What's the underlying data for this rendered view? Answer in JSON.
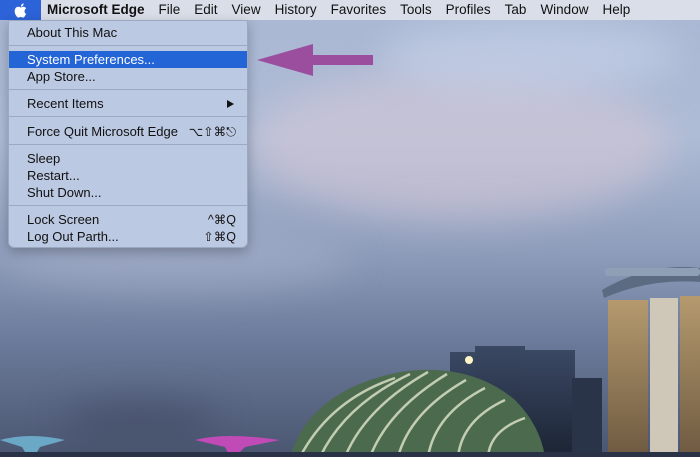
{
  "menubar": {
    "app_name": "Microsoft Edge",
    "items": [
      "File",
      "Edit",
      "View",
      "History",
      "Favorites",
      "Tools",
      "Profiles",
      "Tab",
      "Window",
      "Help"
    ]
  },
  "apple_menu": {
    "about": "About This Mac",
    "system_prefs": "System Preferences...",
    "app_store": "App Store...",
    "recent_items": "Recent Items",
    "force_quit": "Force Quit Microsoft Edge",
    "force_quit_shortcut": "⌥⇧⌘⎋",
    "sleep": "Sleep",
    "restart": "Restart...",
    "shut_down": "Shut Down...",
    "lock_screen": "Lock Screen",
    "lock_screen_shortcut": "^⌘Q",
    "log_out": "Log Out Parth...",
    "log_out_shortcut": "⇧⌘Q"
  },
  "colors": {
    "selection": "#2364d6",
    "menubar_bg": "#d9dee8",
    "annotation_arrow": "#9b4e9e"
  },
  "icons": {
    "apple": "apple-logo-icon",
    "submenu": "chevron-right-icon",
    "annotation": "arrow-left-icon"
  }
}
